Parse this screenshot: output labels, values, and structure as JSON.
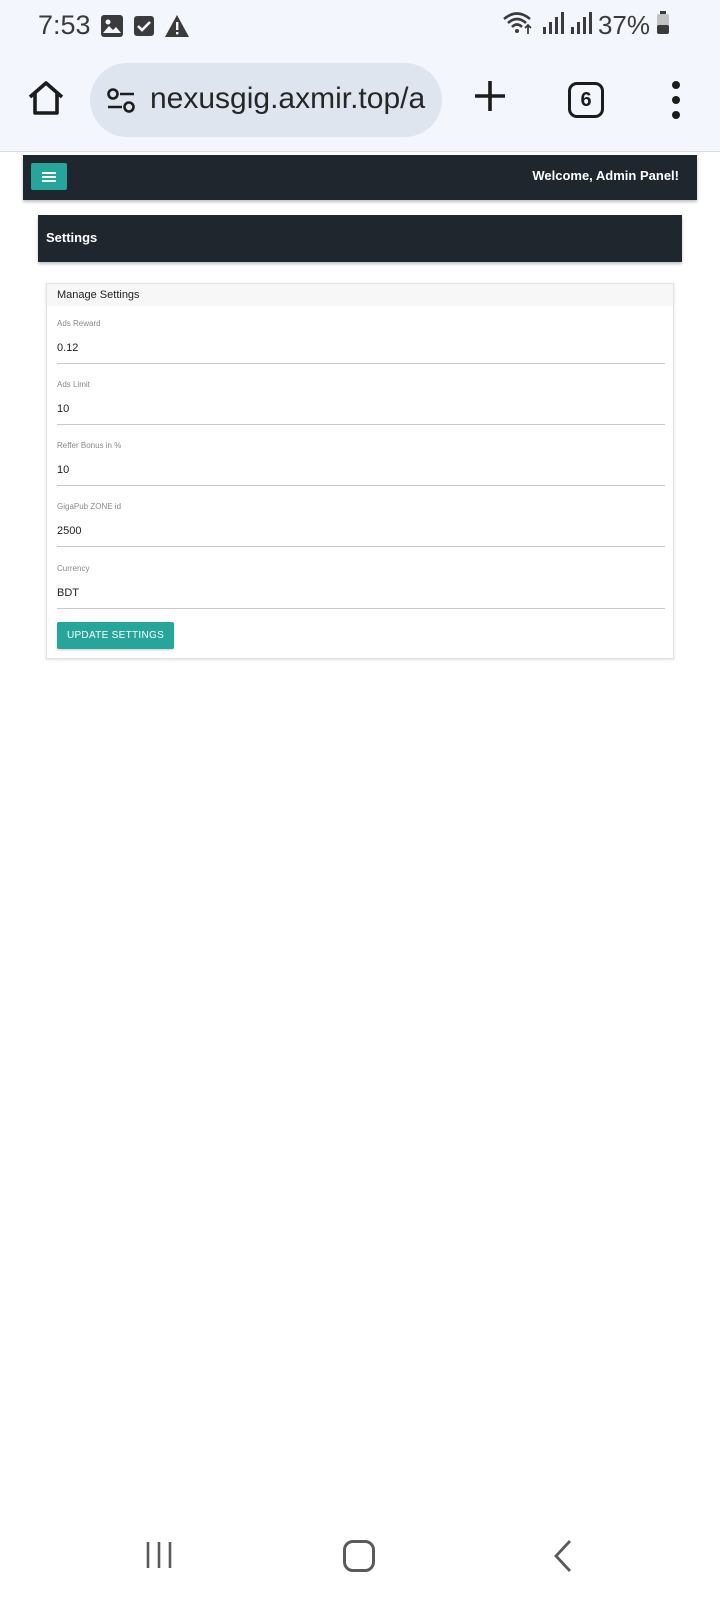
{
  "status_bar": {
    "time": "7:53",
    "battery": "37%",
    "icons": [
      "image-icon",
      "checkbox-icon",
      "warning-icon",
      "wifi-icon",
      "signal-icon",
      "battery-icon"
    ]
  },
  "browser": {
    "url": "nexusgig.axmir.top/a",
    "tab_count": "6"
  },
  "app": {
    "welcome": "Welcome, Admin Panel!",
    "accent_color": "#26a69a",
    "header_color": "#1f262e"
  },
  "page": {
    "title": "Settings",
    "card_title": "Manage Settings",
    "fields": [
      {
        "label": "Ads Reward",
        "value": "0.12"
      },
      {
        "label": "Ads Limit",
        "value": "10"
      },
      {
        "label": "Reffer Bonus in %",
        "value": "10"
      },
      {
        "label": "GigaPub ZONE id",
        "value": "2500"
      },
      {
        "label": "Currency",
        "value": "BDT"
      }
    ],
    "submit_label": "UPDATE SETTINGS"
  }
}
